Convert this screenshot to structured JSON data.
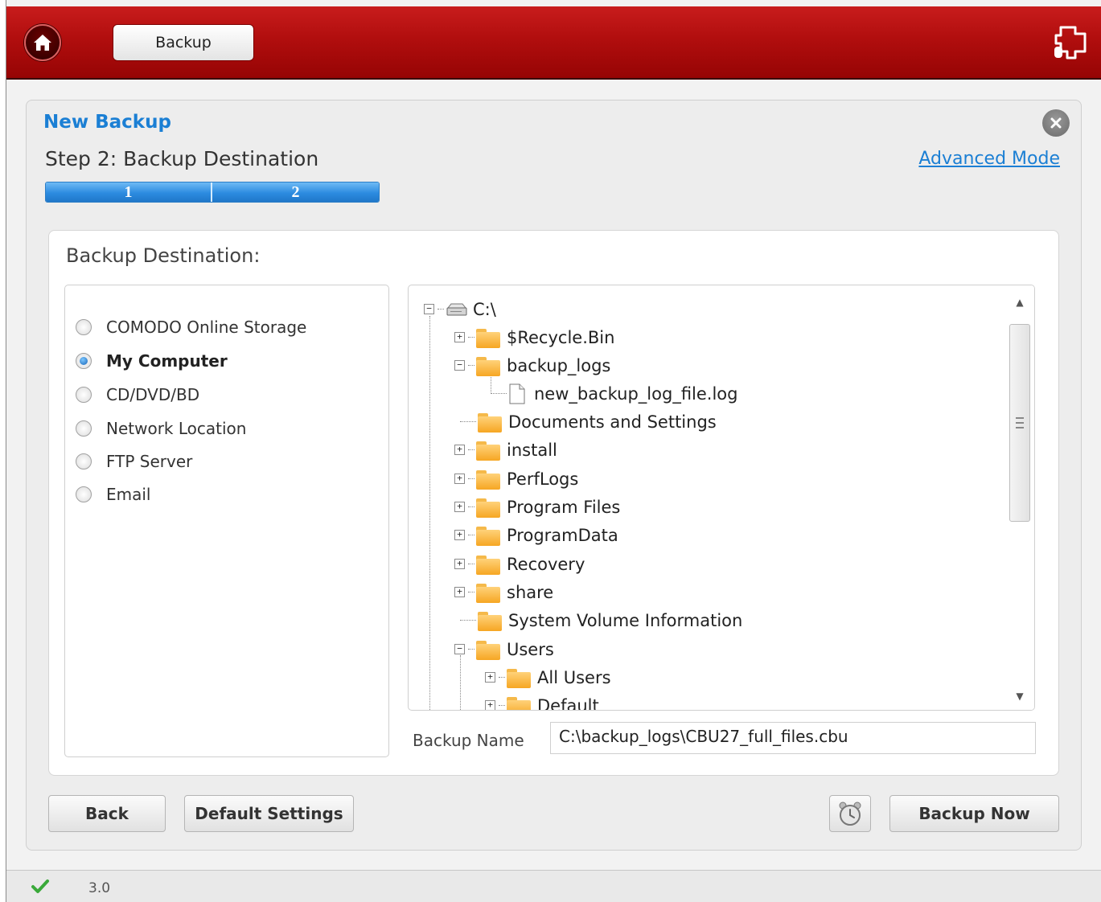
{
  "topbar": {
    "tab_label": "Backup"
  },
  "panel": {
    "title": "New Backup",
    "step_title": "Step 2: Backup Destination",
    "advanced_link": "Advanced Mode",
    "steps": [
      "1",
      "2"
    ],
    "current_step": 2
  },
  "destination": {
    "label": "Backup Destination:",
    "options": [
      {
        "label": "COMODO Online Storage",
        "selected": false
      },
      {
        "label": "My Computer",
        "selected": true
      },
      {
        "label": "CD/DVD/BD",
        "selected": false
      },
      {
        "label": "Network Location",
        "selected": false
      },
      {
        "label": "FTP Server",
        "selected": false
      },
      {
        "label": "Email",
        "selected": false
      }
    ],
    "tree": {
      "root": "C:\\",
      "items": [
        {
          "label": "$Recycle.Bin",
          "type": "folder",
          "expander": "+"
        },
        {
          "label": "backup_logs",
          "type": "folder",
          "expander": "-"
        },
        {
          "label": "new_backup_log_file.log",
          "type": "file",
          "expander": ""
        },
        {
          "label": "Documents and Settings",
          "type": "folder",
          "expander": ""
        },
        {
          "label": "install",
          "type": "folder",
          "expander": "+"
        },
        {
          "label": "PerfLogs",
          "type": "folder",
          "expander": "+"
        },
        {
          "label": "Program Files",
          "type": "folder",
          "expander": "+"
        },
        {
          "label": "ProgramData",
          "type": "folder",
          "expander": "+"
        },
        {
          "label": "Recovery",
          "type": "folder",
          "expander": "+"
        },
        {
          "label": "share",
          "type": "folder",
          "expander": "+"
        },
        {
          "label": "System Volume Information",
          "type": "folder",
          "expander": ""
        },
        {
          "label": "Users",
          "type": "folder",
          "expander": "-"
        },
        {
          "label": "All Users",
          "type": "folder",
          "expander": "+"
        },
        {
          "label": "Default",
          "type": "folder",
          "expander": "+"
        }
      ]
    },
    "backup_name_label": "Backup Name",
    "backup_name_value": "C:\\backup_logs\\CBU27_full_files.cbu"
  },
  "buttons": {
    "back": "Back",
    "default_settings": "Default Settings",
    "schedule_icon": "alarm-clock-icon",
    "backup_now": "Backup Now"
  },
  "status": {
    "version": "3.0",
    "status_icon": "checkmark-icon"
  },
  "colors": {
    "header_red": "#b10e0e",
    "accent_blue": "#1b7fd4",
    "progress_blue": "#2c8be0",
    "check_green": "#3aa93a"
  }
}
